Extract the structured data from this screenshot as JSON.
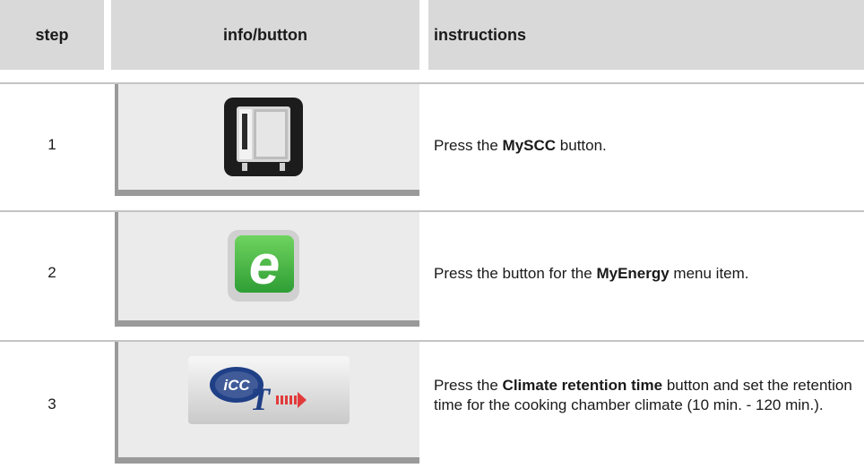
{
  "header": {
    "step": "step",
    "info": "info/button",
    "instructions": "instructions"
  },
  "rows": [
    {
      "step": "1",
      "icon": "mysccc-oven-icon",
      "instr": {
        "before": "Press the ",
        "bold": "MySCC",
        "after": " button."
      }
    },
    {
      "step": "2",
      "icon": "myenergy-e-icon",
      "instr": {
        "before": "Press the button for the ",
        "bold": "MyEnergy",
        "after": " menu item."
      }
    },
    {
      "step": "3",
      "icon": "climate-retention-time-icon",
      "icon_text": "iCC",
      "instr": {
        "before": "Press the ",
        "bold": "Climate retention time",
        "after": " button and set the retention time for the cooking chamber climate (10 min. - 120 min.)."
      }
    }
  ],
  "colors": {
    "header_bg": "#d9d9d9",
    "panel_bg": "#ebebeb",
    "panel_border": "#9a9a9a",
    "energy_green": "#3fb640"
  }
}
